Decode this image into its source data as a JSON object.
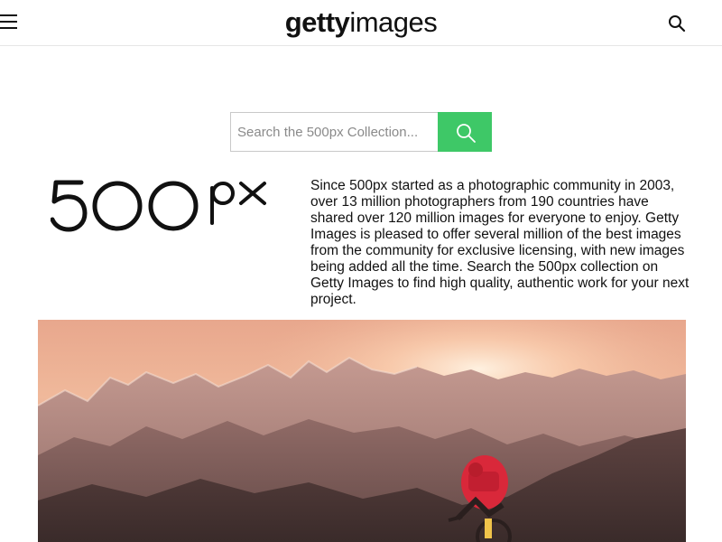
{
  "header": {
    "logo_bold": "getty",
    "logo_light": "images"
  },
  "search": {
    "placeholder": "Search the 500px Collection..."
  },
  "brand": {
    "logo_text": "500px"
  },
  "intro": {
    "text": "Since 500px started as a photographic community in 2003, over 13 million photographers from 190 countries have shared over 120 million images for everyone to enjoy. Getty Images is pleased to offer several million of the best images from the community for exclusive licensing, with new images being added all the time. Search the 500px collection on Getty Images to find high quality, authentic work for your next project."
  },
  "icons": {
    "menu": "menu-icon",
    "search": "search-icon"
  },
  "colors": {
    "accent_green": "#3ec867"
  }
}
